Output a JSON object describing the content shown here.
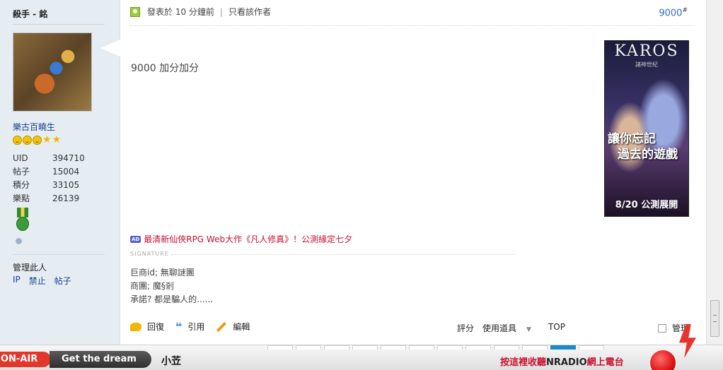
{
  "profile": {
    "username": "殺手 - 銘",
    "group": "樂古百曉生",
    "stats": [
      {
        "label": "UID",
        "value": "394710"
      },
      {
        "label": "帖子",
        "value": "15004"
      },
      {
        "label": "積分",
        "value": "33105"
      },
      {
        "label": "樂點",
        "value": "26139"
      }
    ],
    "manage_title": "管理此人",
    "manage_links": [
      "IP",
      "禁止",
      "帖子"
    ]
  },
  "post": {
    "posted_at": "發表於 10 分鐘前",
    "separator": "|",
    "only_author": "只看該作者",
    "floor": "9000",
    "floor_mark": "#",
    "body": "9000 加分加分",
    "promo_tag": "AD",
    "promo_text": "最清新仙俠RPG Web大作《凡人修真》！公測緣定七夕",
    "signature_label": "SIGNATURE",
    "signature_lines": [
      "巨商id; 無聊謎團",
      "商團; 魔§剎",
      "承諾? 都是騙人的......"
    ],
    "actions": {
      "reply": "回復",
      "quote": "引用",
      "edit": "編輯"
    },
    "right_actions": {
      "rate": "評分",
      "tools": "使用道具",
      "top": "TOP"
    },
    "manage": "管理"
  },
  "ad": {
    "logo": "KAROS",
    "subtitle": "諸神世紀",
    "slogan_1": "讓你忘記",
    "slogan_2": "過去的遊戲",
    "date": "8/20 公測展開"
  },
  "radio": {
    "onair": "ON-AIR",
    "tagline": "Get the dream",
    "song": "小苙",
    "listen_prefix": "按這裡收聽",
    "listen_brand": "NRADIO",
    "listen_suffix": "網上電台"
  },
  "colors": {
    "link": "#1a3f8c",
    "promo": "#c8102e",
    "sidebar_bg": "#e5edf2",
    "onair": "#e4372c"
  }
}
